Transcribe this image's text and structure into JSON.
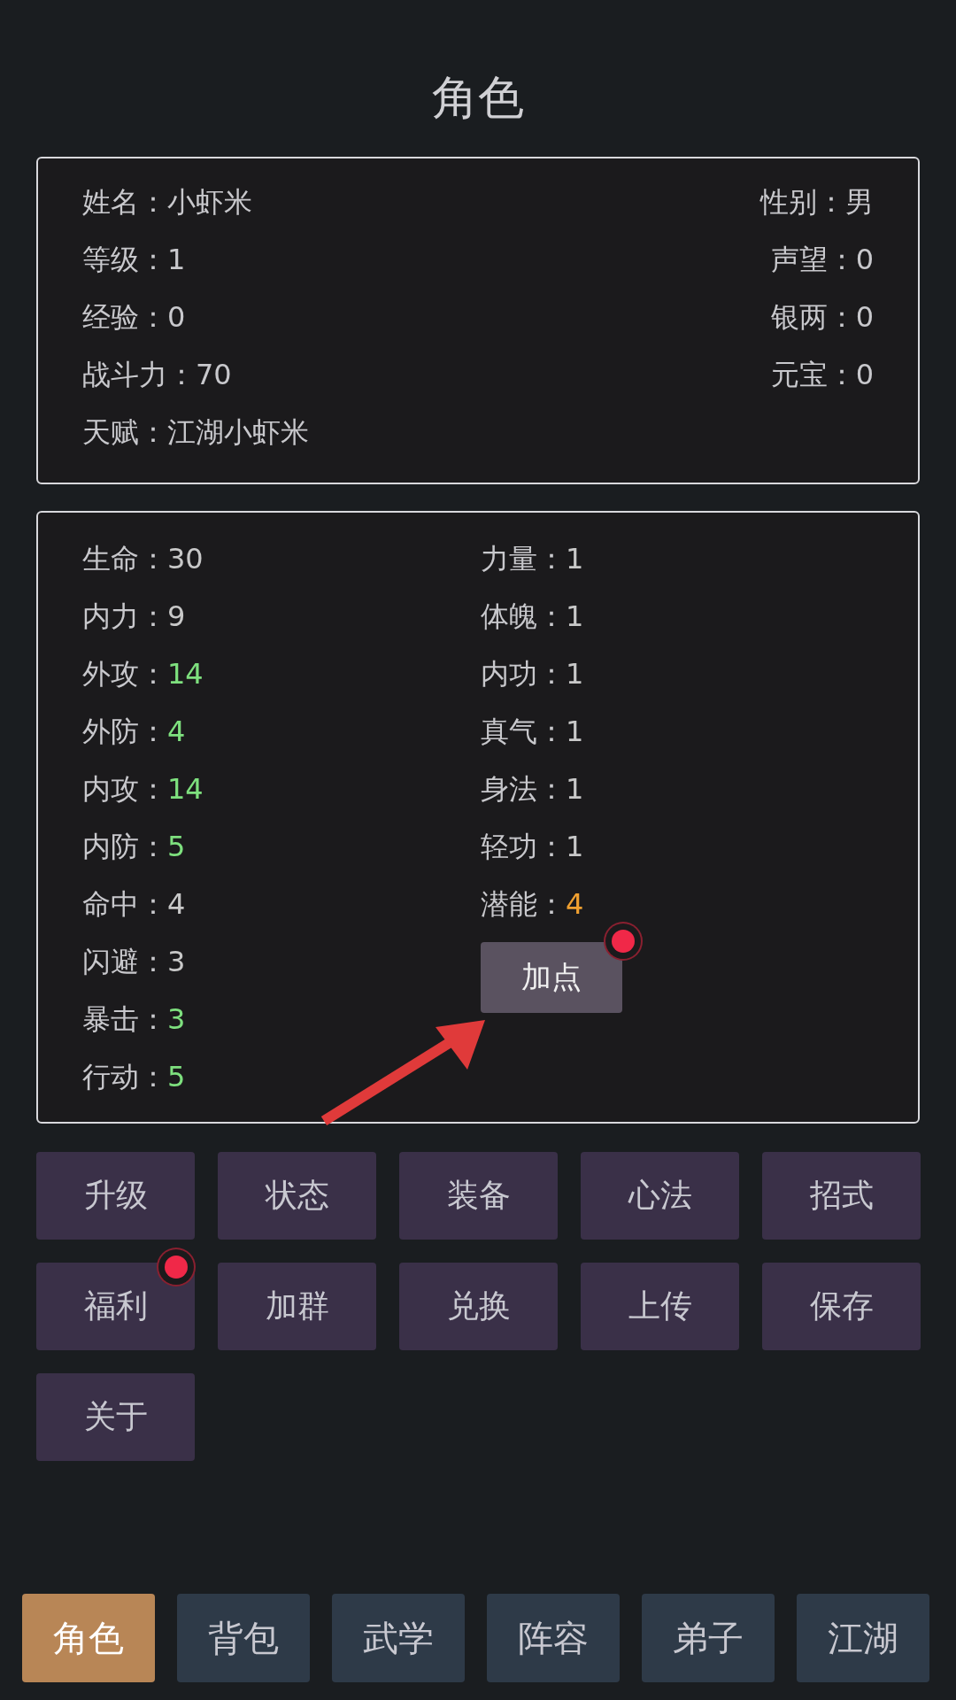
{
  "title": "角色",
  "profile": {
    "left": [
      {
        "label": "姓名：",
        "value": "小虾米"
      },
      {
        "label": "等级：",
        "value": "1"
      },
      {
        "label": "经验：",
        "value": "0"
      },
      {
        "label": "战斗力：",
        "value": "70"
      },
      {
        "label": "天赋：",
        "value": "江湖小虾米"
      }
    ],
    "right": [
      {
        "label": "性别：",
        "value": "男"
      },
      {
        "label": "声望：",
        "value": "0"
      },
      {
        "label": "银两：",
        "value": "0"
      },
      {
        "label": "元宝：",
        "value": "0"
      }
    ]
  },
  "stats": {
    "left": [
      {
        "label": "生命：",
        "value": "30",
        "color": "#c8c8c8"
      },
      {
        "label": "内力：",
        "value": "9",
        "color": "#c8c8c8"
      },
      {
        "label": "外攻：",
        "value": "14",
        "color": "#7ee07e"
      },
      {
        "label": "外防：",
        "value": "4",
        "color": "#7ee07e"
      },
      {
        "label": "内攻：",
        "value": "14",
        "color": "#7ee07e"
      },
      {
        "label": "内防：",
        "value": "5",
        "color": "#7ee07e"
      },
      {
        "label": "命中：",
        "value": "4",
        "color": "#c8c8c8"
      },
      {
        "label": "闪避：",
        "value": "3",
        "color": "#c8c8c8"
      },
      {
        "label": "暴击：",
        "value": "3",
        "color": "#7ee07e"
      },
      {
        "label": "行动：",
        "value": "5",
        "color": "#7ee07e"
      }
    ],
    "right": [
      {
        "label": "力量：",
        "value": "1",
        "color": "#c8c8c8"
      },
      {
        "label": "体魄：",
        "value": "1",
        "color": "#c8c8c8"
      },
      {
        "label": "内功：",
        "value": "1",
        "color": "#c8c8c8"
      },
      {
        "label": "真气：",
        "value": "1",
        "color": "#c8c8c8"
      },
      {
        "label": "身法：",
        "value": "1",
        "color": "#c8c8c8"
      },
      {
        "label": "轻功：",
        "value": "1",
        "color": "#c8c8c8"
      },
      {
        "label": "潜能：",
        "value": "4",
        "color": "#f0a030"
      }
    ],
    "add_button": {
      "label": "加点",
      "badge": true
    }
  },
  "buttons": [
    {
      "label": "升级",
      "badge": false
    },
    {
      "label": "状态",
      "badge": false
    },
    {
      "label": "装备",
      "badge": false
    },
    {
      "label": "心法",
      "badge": false
    },
    {
      "label": "招式",
      "badge": false
    },
    {
      "label": "福利",
      "badge": true
    },
    {
      "label": "加群",
      "badge": false
    },
    {
      "label": "兑换",
      "badge": false
    },
    {
      "label": "上传",
      "badge": false
    },
    {
      "label": "保存",
      "badge": false
    },
    {
      "label": "关于",
      "badge": false
    }
  ],
  "tabs": [
    {
      "label": "角色",
      "selected": true
    },
    {
      "label": "背包",
      "selected": false
    },
    {
      "label": "武学",
      "selected": false
    },
    {
      "label": "阵容",
      "selected": false
    },
    {
      "label": "弟子",
      "selected": false
    },
    {
      "label": "江湖",
      "selected": false
    }
  ]
}
